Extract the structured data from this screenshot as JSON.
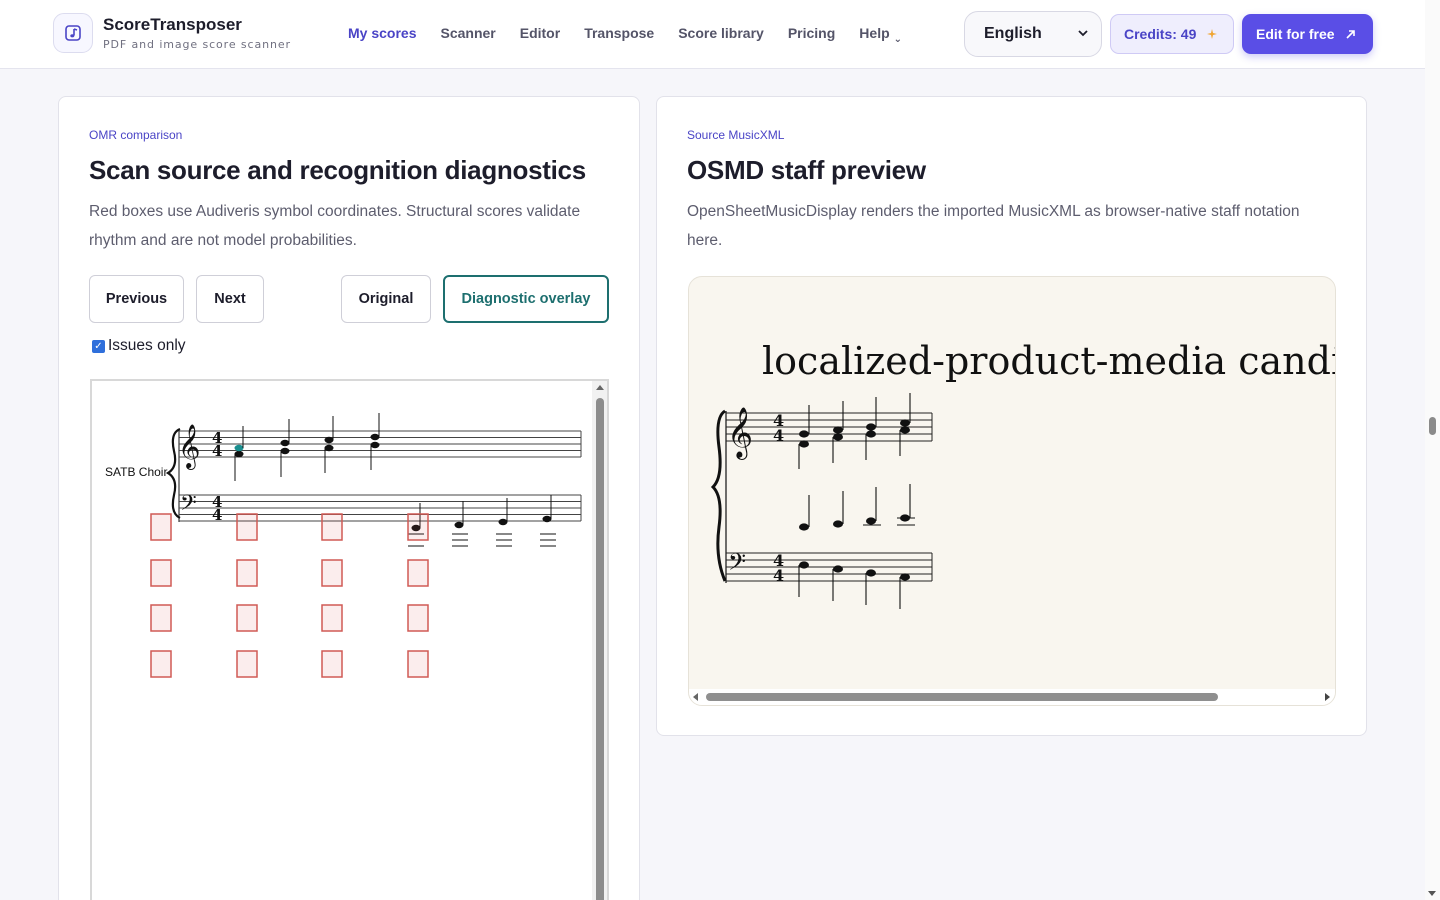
{
  "header": {
    "brand_name": "ScoreTransposer",
    "brand_tagline": "PDF and image score scanner",
    "nav": [
      {
        "label": "My scores",
        "active": true
      },
      {
        "label": "Scanner"
      },
      {
        "label": "Editor"
      },
      {
        "label": "Transpose"
      },
      {
        "label": "Score library"
      },
      {
        "label": "Pricing"
      },
      {
        "label": "Help",
        "has_dropdown": true
      }
    ],
    "language": "English",
    "credits_label": "Credits: 49",
    "cta_label": "Edit for free",
    "accent_color": "#5a4ee6"
  },
  "left_card": {
    "eyebrow": "OMR comparison",
    "title": "Scan source and recognition diagnostics",
    "description": "Red boxes use Audiveris symbol coordinates. Structural scores validate rhythm and are not model probabilities.",
    "buttons": {
      "previous": "Previous",
      "next": "Next",
      "original": "Original",
      "diagnostic": "Diagnostic overlay"
    },
    "issues_only_label": "Issues only",
    "issues_only_checked": true,
    "score": {
      "part_label": "SATB Choir",
      "time_signature": "4/4",
      "issue_box_color": "#d9534f"
    }
  },
  "right_card": {
    "eyebrow": "Source MusicXML",
    "title": "OSMD staff preview",
    "description": "OpenSheetMusicDisplay renders the imported MusicXML as browser-native staff notation here.",
    "score_title": "localized-product-media candidate s",
    "time_signature": "4/4"
  }
}
